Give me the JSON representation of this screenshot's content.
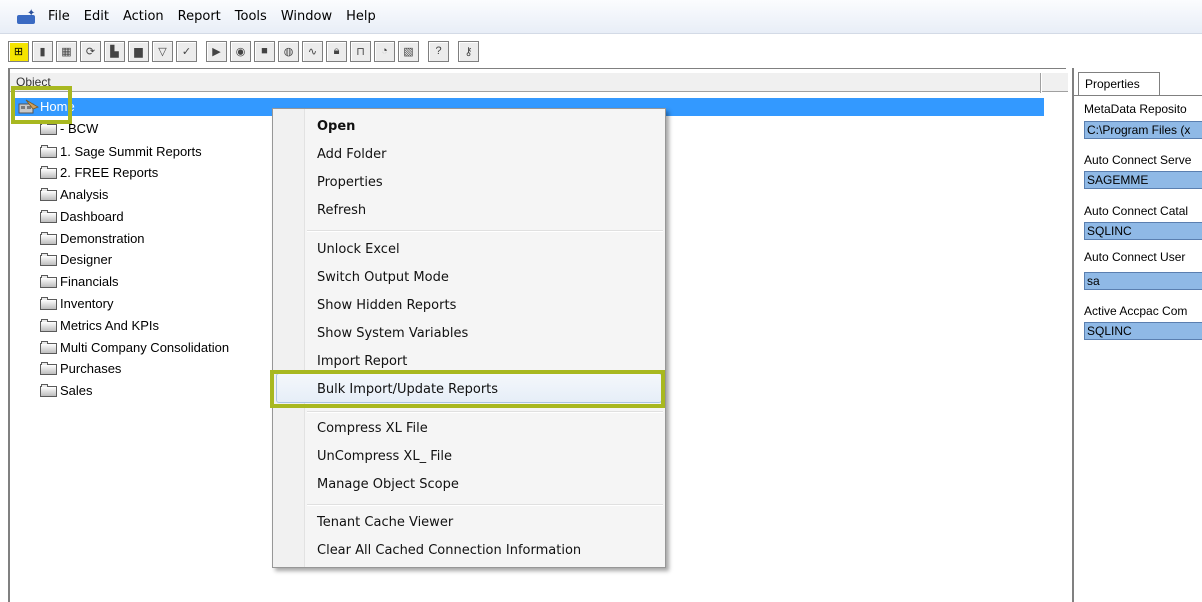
{
  "menubar": {
    "items": [
      "File",
      "Edit",
      "Action",
      "Report",
      "Tools",
      "Window",
      "Help"
    ]
  },
  "toolbar": {
    "buttons": [
      "new-icon",
      "delete-icon",
      "grid-icon",
      "refresh-icon",
      "copy-icon",
      "paste-icon",
      "filter-icon",
      "check-icon",
      "run-icon",
      "record-icon",
      "stop-icon",
      "globe-icon",
      "chart-icon",
      "lock-icon",
      "unlock-icon",
      "disc-icon",
      "image-icon",
      "help-icon",
      "key-icon"
    ]
  },
  "tree": {
    "column_header": "Object",
    "home_label": "Home",
    "items": [
      "- BCW",
      "1. Sage Summit Reports",
      "2. FREE Reports",
      "Analysis",
      "Dashboard",
      "Demonstration",
      "Designer",
      "Financials",
      "Inventory",
      "Metrics And KPIs",
      "Multi Company Consolidation",
      "Purchases",
      "Sales"
    ]
  },
  "context_menu": {
    "items": [
      "Open",
      "Add Folder",
      "Properties",
      "Refresh",
      "Unlock Excel",
      "Switch Output Mode",
      "Show Hidden Reports",
      "Show System Variables",
      "Import Report",
      "Bulk Import/Update Reports",
      "Compress XL File",
      "UnCompress XL_ File",
      "Manage Object Scope",
      "Tenant Cache Viewer",
      "Clear All Cached Connection Information"
    ],
    "hovered": "Bulk Import/Update Reports"
  },
  "properties": {
    "tab_label": "Properties",
    "fields": [
      {
        "label": "MetaData Reposito",
        "value": "C:\\Program Files (x"
      },
      {
        "label": "Auto Connect Serve",
        "value": "SAGEMME"
      },
      {
        "label": "Auto Connect Catal",
        "value": "SQLINC"
      },
      {
        "label": "Auto Connect User",
        "value": "sa"
      },
      {
        "label": "Active Accpac Com",
        "value": "SQLINC"
      }
    ]
  },
  "colors": {
    "selection": "#3399ff",
    "highlight_outline": "#a8b820",
    "property_value_bg": "#8fb9e6"
  }
}
